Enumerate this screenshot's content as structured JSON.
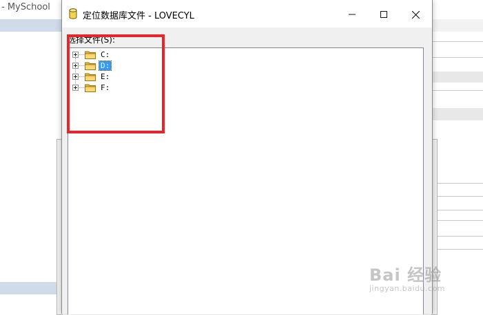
{
  "background_app": {
    "title": "- MySchool"
  },
  "dialog": {
    "title": "定位数据库文件 - LOVECYL",
    "select_label": "选择文件(S):",
    "buttons": {
      "minimize": "─",
      "maximize": "☐",
      "close": "✕"
    },
    "tree": {
      "items": [
        {
          "label": "C:",
          "selected": false
        },
        {
          "label": "D:",
          "selected": true
        },
        {
          "label": "E:",
          "selected": false
        },
        {
          "label": "F:",
          "selected": false
        }
      ]
    }
  },
  "watermark": {
    "main": "Bai 经验",
    "sub": "jingyan.baidu.com"
  },
  "colors": {
    "annotation": "#e8252a",
    "selection": "#3399ff",
    "app_bar": "#cfdbe8"
  }
}
